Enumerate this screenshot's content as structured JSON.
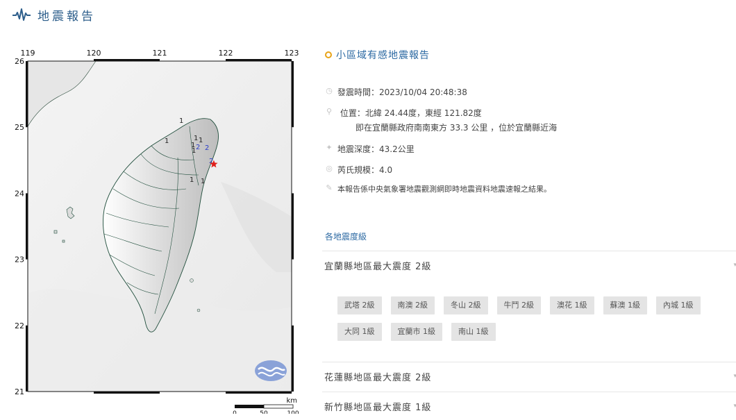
{
  "header": {
    "title": "地震報告",
    "icon": "seismograph-icon",
    "accent": "#2d5e8b"
  },
  "map": {
    "lon_ticks": [
      "119",
      "120",
      "121",
      "122",
      "123"
    ],
    "lat_ticks": [
      "26",
      "25",
      "24",
      "23",
      "22",
      "21"
    ],
    "scale": {
      "unit": "km",
      "labels": [
        "0",
        "50",
        "100"
      ]
    },
    "epicenter": {
      "lat": 24.44,
      "lon": 121.82,
      "color": "#e0201b"
    },
    "station_marks": [
      {
        "label": "1",
        "color": "#222"
      },
      {
        "label": "1",
        "color": "#222"
      },
      {
        "label": "1",
        "color": "#222"
      },
      {
        "label": "1",
        "color": "#222"
      },
      {
        "label": "1",
        "color": "#222"
      },
      {
        "label": "1",
        "color": "#222"
      },
      {
        "label": "1",
        "color": "#222"
      },
      {
        "label": "1",
        "color": "#222"
      },
      {
        "label": "2",
        "color": "#2b3ec9"
      },
      {
        "label": "2",
        "color": "#2b3ec9"
      },
      {
        "label": "2",
        "color": "#2b3ec9"
      }
    ],
    "logo": "cwa-logo"
  },
  "report": {
    "title": "小區域有感地震報告",
    "time": "發震時間：2023/10/04 20:48:38",
    "location": "位置：北緯 24.44度，東經 121.82度",
    "location_detail": "即在宜蘭縣政府南南東方 33.3 公里 ，位於宜蘭縣近海",
    "depth": "地震深度：43.2公里",
    "magnitude": "芮氏規模：4.0",
    "note": "本報告係中央氣象署地震觀測網即時地震資料地震速報之結果。",
    "dot_color": "#e8a317"
  },
  "intensity": {
    "section_label": "各地震度級",
    "counties": [
      {
        "title": "宜蘭縣地區最大震度 2級",
        "stations": [
          "武塔 2級",
          "南澳 2級",
          "冬山 2級",
          "牛鬥 2級",
          "澳花 1級",
          "蘇澳 1級",
          "內城 1級",
          "大同 1級",
          "宜蘭市 1級",
          "南山 1級"
        ]
      },
      {
        "title": "花蓮縣地區最大震度 2級",
        "stations": []
      },
      {
        "title": "新竹縣地區最大震度 1級",
        "stations": []
      }
    ]
  }
}
